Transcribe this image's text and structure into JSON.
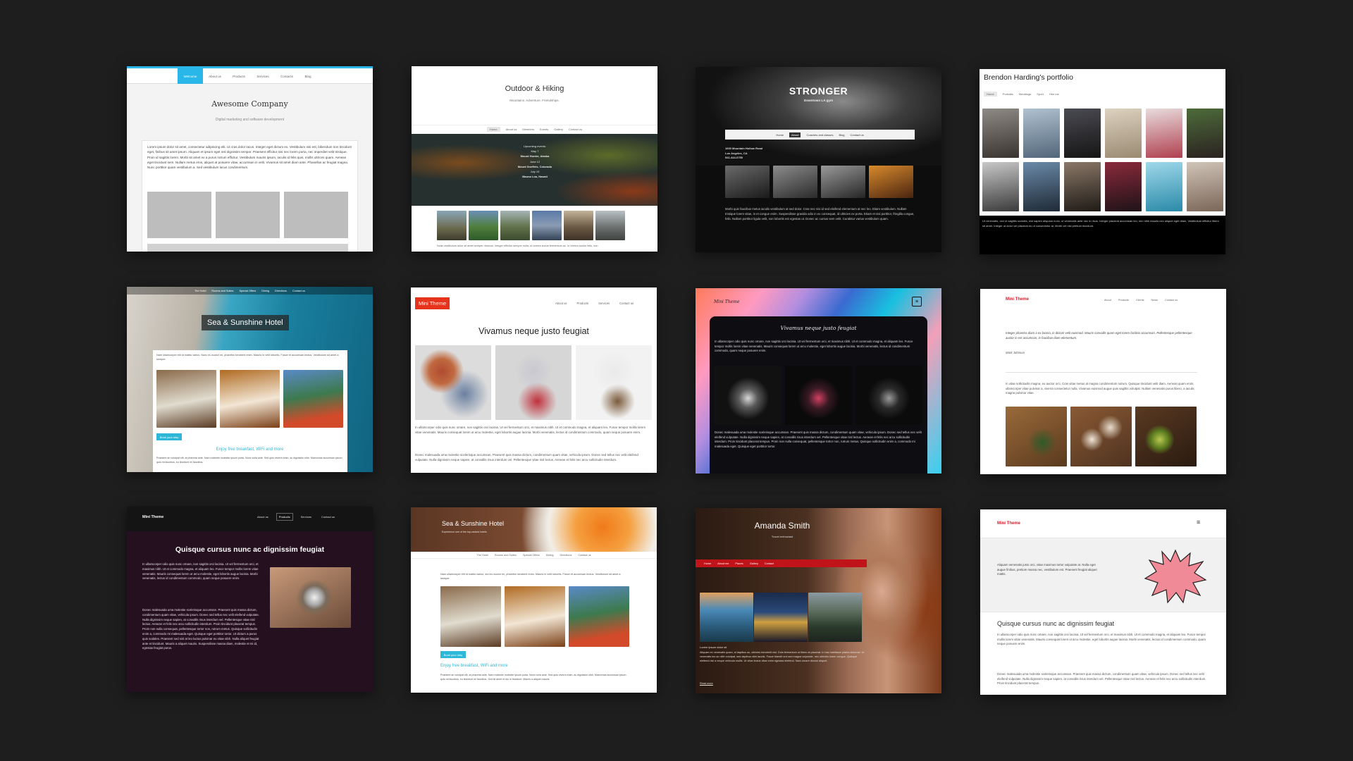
{
  "screen": {
    "background": "#1e1e1e"
  },
  "t1": {
    "nav": [
      "Welcome",
      "About us",
      "Products",
      "Services",
      "Contacts",
      "Blog"
    ],
    "title": "Awesome Company",
    "subtitle": "Digital marketing and software development",
    "body": "Lorem ipsum dolor sit amet, consectetur adipiscing elit. Ut cras dolor lacus. Integer eget dictum ex. Vestibulum nisi est, bibendum non tincidunt eget, finibus sit amet ipsum. Aliquam et ipsum eget nisl dignissim tempor. Praesent efficitur nisi nec lorem porta, nec imperdiet velit tristique. Proin id sagittis lorem. Morbi sit amet ex a purus rutrum efficitur. Vestibulum mauris ipsum, iaculis id felis quis, mollis ultrices quam. Aenean eget tincidunt sem. Nullam metus eros, aliquet at posuere vitae, accumsan in velit. Vivamus sit amet diam ante. Phasellus ac feugiat magna. Nunc porttitor quam vestibulum a. Sed vestibulum lacus condimentum.",
    "accent": "#29b6e8"
  },
  "t2": {
    "title": "Outdoor & Hiking",
    "subtitle": "Mountains. Adventure. Friendships.",
    "nav": [
      "Home",
      "About us",
      "Members",
      "Events",
      "Gallery",
      "Contact us"
    ],
    "events_title": "Upcoming events:",
    "events": [
      "May 7",
      "Mount Hunter, Alaska",
      "June 12",
      "Mount Sneffels, Colorado",
      "July 19",
      "Mauna Loa, Hawaii"
    ],
    "footer": "Nulla vestibulum dolor sit amet semper rhoncus. Integer efficitur semper nulla, ut viverra lectus fermentum ac. In viverra auctor felis, non"
  },
  "t3": {
    "title": "STRONGER",
    "subtitle": "Downtown LA gym",
    "nav": [
      "Home",
      "About",
      "Coaches and classes",
      "Blog",
      "Contact us"
    ],
    "address": [
      "1600 Mountain Hollow Road",
      "Los Angeles, CA",
      "541-444-0755"
    ],
    "body": "Morbi quis faucibus metus iaculis vestibulum at sed dolor. Cras nec nisi id sed eleifend elementum at nec leo. Etiam vestibulum. Nullam tristique lorem vitae, in et congue enim. Suspendisse gravida odio in ex consequat, id ultricies ex porta. Etiam et nisi porttitor, fringilla congue, felis. Nullam porttitor ligula velit, non lobortis est egestas ut. Donec ac cursus sem velit. Curabitur varius vestibulum quam."
  },
  "t4": {
    "title": "Brendon Harding's portfolio",
    "nav": [
      "Home",
      "Portraits",
      "Weddings",
      "Sport",
      "Hire me"
    ],
    "footer": "Ut venenatis, orci ut sagittis sodales, nisl sapien aliquam nunc, ut venenatis ante nec in risus. Integer placerat accumsan leo, nec nibh mauris nec aliquet eget diam. Vestibulum efficitur libero sit amet. Integer ut dolor vel placerat eu ut consectetur at. Morbi vel nisl pretium tincidunt."
  },
  "t5": {
    "nav": [
      "The Hotel",
      "Rooms and Suites",
      "Special Offers",
      "Dining",
      "Directions",
      "Contact us"
    ],
    "title": "Sea & Sunshine Hotel",
    "intro": "Nam ullamcorper elit id mattis varius. Nunc eu auctor mi, pharetra hendrerit enim. Mauris in velit lobortis. Fusce et accumsan lectus. Vestibulum sit amet a semper.",
    "cta": "Book your stay",
    "tagline": "Enjoy free breakfast, WiFi and more",
    "footer": "Praesent an volutpat elit, at pharetra ante. Nam molestie molestie ipsum porta. Nunc vulla ante. Sed quis viverra enim, ac dignissim nibh. Maecenas accumsan ipsum quis mi faucibus, eu tincidunt mi faucibus."
  },
  "t6": {
    "brand": "Mini Theme",
    "nav": [
      "About us",
      "Products",
      "Services",
      "Contact us"
    ],
    "title": "Vivamus neque justo feugiat",
    "p1": "In ullamcorper odio quis nunc ornare, non sagittis orci lacinia. Ut vel fermentum orci, et maximus nibh. Ut et commodo magna, et aliquam leo. Fusce tempor mollis lorem vitae venenatis. Mauris consequat lorem ut arcu molestie, eget lobortis augue lacinia. Morbi venenatis, lectus id condimentum commodo, quam neque posuere enim.",
    "p2": "Donec malesuada uma molestie scelerisque accumsan. Praesent quis massa dictum, condimentum quam vitae, vehicula ipsum. Donec sed tellus nec velit eleifend vulputate. Nulla dignissim neque sapien, at convallis risus interdum vel. Pellentesque vitae nisl lectus. Aenean et felis nec arcu sollicitudin interdum.",
    "brand_color": "#e8331c"
  },
  "t7": {
    "brand": "Mini Theme",
    "title": "Vivamus neque justo feugiat",
    "p1": "In ullamcorper odio quis nunc ornare, non sagittis orci lacinia. Ut vel fermentum orci, et maximus nibh. Ut et commodo magna, et aliquam leo. Fusce tempor mollis lorem vitae venenatis. Mauris consequat lorem ut arcu molestie, eget lobortis augue lacinia. Morbi venenatis, lectus id condimentum commodo, quam neque posuere enim.",
    "p2": "Donec malesuada uma molestie scelerisque accumsan. Praesent quis massa dictum, condimentum quam vitae, vehicula ipsum. Donec sed tellus nec velit eleifend vulputate. Nulla dignissim neque sapien, at convallis risus interdum vel. Pellentesque vitae nisl lectus. Aenean et felis nec arcu sollicitudin interdum. Proin tincidunt placerat tempus. Proin non nulla consequat, pellentesque tortor non, rutrum metus. Quisque sollicitudin enim a, commodo mi malesuada eget. Quisque eget porttitor tortor."
  },
  "t8": {
    "brand": "Mini Theme",
    "nav": [
      "About",
      "Products",
      "Clients",
      "News",
      "Contact us"
    ],
    "quote": "Integer pharetra diam a ex lacinia, in dictum velit euismod. Mauris convallis quam eget lorem facilisis accumsan. Pellentesque pellentesque auctor in est accumsan, in faucibus diam elementum.",
    "author": "Mark Johnson",
    "body": "In vitae sollicitudin magna, eu auctor orci. Cras vitae metus at magna condimentum rutrum. Quisque tincidunt velit diam. Aenean quam enim, ullamcorper vitae pulvinar a, viverra consectetur nulla. Vivamus euismod augue quis sagittis volutpat. Nullam venenatis purus libero, a iaculis magna pulvinar vitae."
  },
  "t9": {
    "brand": "Mini Theme",
    "nav": [
      "About us",
      "Products",
      "Services",
      "Contact us"
    ],
    "title": "Quisque cursus nunc ac dignissim feugiat",
    "p1": "In ullamcorper odio quis nunc ornare, non sagittis orci lacinia. Ut vel fermentum orci, et maximus nibh. Ut et commodo magna, et aliquam leo. Fusce tempor mollis lorem vitae venenatis. Mauris consequat lorem ut arcu molestie, eget lobortis augue lacinia. Morbi venenatis, lectus id condimentum commodo, quam neque posuere enim.",
    "p2": "Donec malesuada uma molestie scelerisque accumsan. Praesent quis massa dictum, condimentum quam vitae, vehicula ipsum. Donec sed tellus nec velit eleifend vulputate. Nulla dignissim neque sapien, at convallis risus interdum vel. Pellentesque vitae nisl lectus. Aenean et felis nec arcu sollicitudin interdum. Proin tincidunt placerat tempus. Proin non nulla consequat, pellentesque tortor non, rutrum metus. Quisque sollicitudin enim a, commodo mi malesuada eget. Quisque eget porttitor tortor. Ut dictum a purus quis sodales. Praesent sed nisl at leo luctus pulvinar eu vitae nibh. Nulla aliquet feugiat ante et tincidunt. Mauris a aliquet mauris. Suspendisse massa diam, molestie et mi id, egestas feugiat purus."
  },
  "t10": {
    "title": "Sea & Sunshine Hotel",
    "subtitle": "Experience one of the top-ranked hotels",
    "nav": [
      "The Hotel",
      "Rooms and Suites",
      "Special Offers",
      "Dining",
      "Directions",
      "Contact us"
    ],
    "intro": "Nam ullamcorper elit id mattis varius, dui leo auctor mi, pharetra hendrerit enim. Mauris in velit lobortis. Fusce et accumsan lectus. Vestibulum sit amet a semper.",
    "cta": "Book your stay",
    "tagline": "Enjoy free breakfast, WiFi and more",
    "footer": "Praesent an volutpat elit, at pharetra ante. Nam molestie molestie ipsum porta. Nunc vulla ante. Sed quis viverra enim, ac dignissim nibh. Maecenas accumsan ipsum quis mi faucibus, eu tincidunt mi faucibus. Sed sit amet et dui in tincidunt. Mauris a aliquet mauris."
  },
  "t11": {
    "title": "Amanda Smith",
    "subtitle": "Travel enthusiast",
    "nav": [
      "Home",
      "About me",
      "Places",
      "Gallery",
      "Contact"
    ],
    "caption": "Lorem ipsum dolor sit",
    "body": "Aliquam ex venenatis quam, id dapibus ac, ultricies hendrerit nisl. Duis fermentum ut libero at placerat. In hac habitasse platea dictumst. Ut venenatis leo ac nibh volutpat, sed dapibus nibh iaculis. Fusce blandit orci sed magna vulputate, nec ultricies lorem congue. Quisque eleifend nisl a neque vehicula mollis. Ut vitae lectus vitae enim egestas eleifend. Nam ornare dictum aliquet.",
    "link": "Read more",
    "accent": "#c0141a"
  },
  "t12": {
    "brand": "Mini Theme",
    "hero": "Aliquam venenatis justo orci, vitae maximus tortor vulputate at. Nulla eget augue finibus, pretium massa nec, vestibulum est. Praesent feugiat aliquet mattis.",
    "title": "Quisque cursus nunc ac dignissim feugiat",
    "p1": "In ullamcorper odio quis nunc ornare, non sagittis orci lacinia. Ut vel fermentum orci, et maximus nibh. Ut et commodo magna, et aliquam leo. Fusce tempor mollis lorem vitae venenatis. Mauris consequat lorem ut arcu molestie, eget lobortis augue lacinia. Morbi venenatis, lectus id condimentum commodo, quam neque posuere enim.",
    "p2": "Donec malesuada uma molestie scelerisque accumsan. Praesent quis massa dictum, condimentum quam vitae, vehicula ipsum. Donec sed tellus nec velit eleifend vulputate. Nulla dignissim neque sapien, at convallis risus interdum vel. Pellentesque vitae nisl lectus. Aenean et felis nec arcu sollicitudin interdum. Proin tincidunt placerat tempus.",
    "menu_icon": "hamburger-menu-icon"
  }
}
